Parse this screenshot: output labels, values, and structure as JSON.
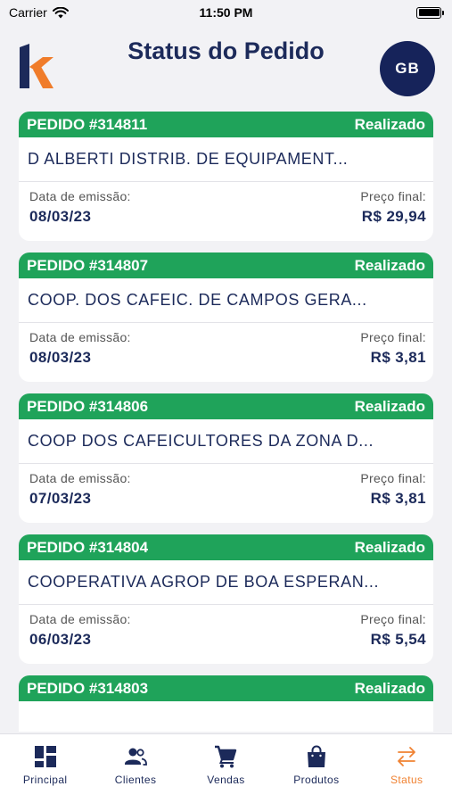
{
  "status_bar": {
    "carrier": "Carrier",
    "time": "11:50 PM"
  },
  "header": {
    "title": "Status do Pedido",
    "avatar_initials": "GB"
  },
  "orders": [
    {
      "pedido": "PEDIDO #314811",
      "status": "Realizado",
      "client": "D ALBERTI DISTRIB. DE EQUIPAMENT...",
      "date_label": "Data de emissão:",
      "date": "08/03/23",
      "price_label": "Preço final:",
      "price": "R$ 29,94"
    },
    {
      "pedido": "PEDIDO #314807",
      "status": "Realizado",
      "client": "COOP. DOS CAFEIC. DE CAMPOS GERA...",
      "date_label": "Data de emissão:",
      "date": "08/03/23",
      "price_label": "Preço final:",
      "price": "R$ 3,81"
    },
    {
      "pedido": "PEDIDO #314806",
      "status": "Realizado",
      "client": "COOP DOS CAFEICULTORES DA ZONA D...",
      "date_label": "Data de emissão:",
      "date": "07/03/23",
      "price_label": "Preço final:",
      "price": "R$ 3,81"
    },
    {
      "pedido": "PEDIDO #314804",
      "status": "Realizado",
      "client": "COOPERATIVA AGROP DE BOA ESPERAN...",
      "date_label": "Data de emissão:",
      "date": "06/03/23",
      "price_label": "Preço final:",
      "price": "R$ 5,54"
    },
    {
      "pedido": "PEDIDO #314803",
      "status": "Realizado",
      "client": "",
      "date_label": "",
      "date": "",
      "price_label": "",
      "price": ""
    }
  ],
  "tabs": [
    {
      "label": "Principal",
      "icon": "dashboard-icon",
      "active": false
    },
    {
      "label": "Clientes",
      "icon": "people-icon",
      "active": false
    },
    {
      "label": "Vendas",
      "icon": "cart-icon",
      "active": false
    },
    {
      "label": "Produtos",
      "icon": "bag-icon",
      "active": false
    },
    {
      "label": "Status",
      "icon": "swap-arrows-icon",
      "active": true
    }
  ],
  "colors": {
    "accent_green": "#1fa35a",
    "navy": "#1c2a5a",
    "active_tab": "#f08232",
    "avatar_bg": "#16235a"
  }
}
